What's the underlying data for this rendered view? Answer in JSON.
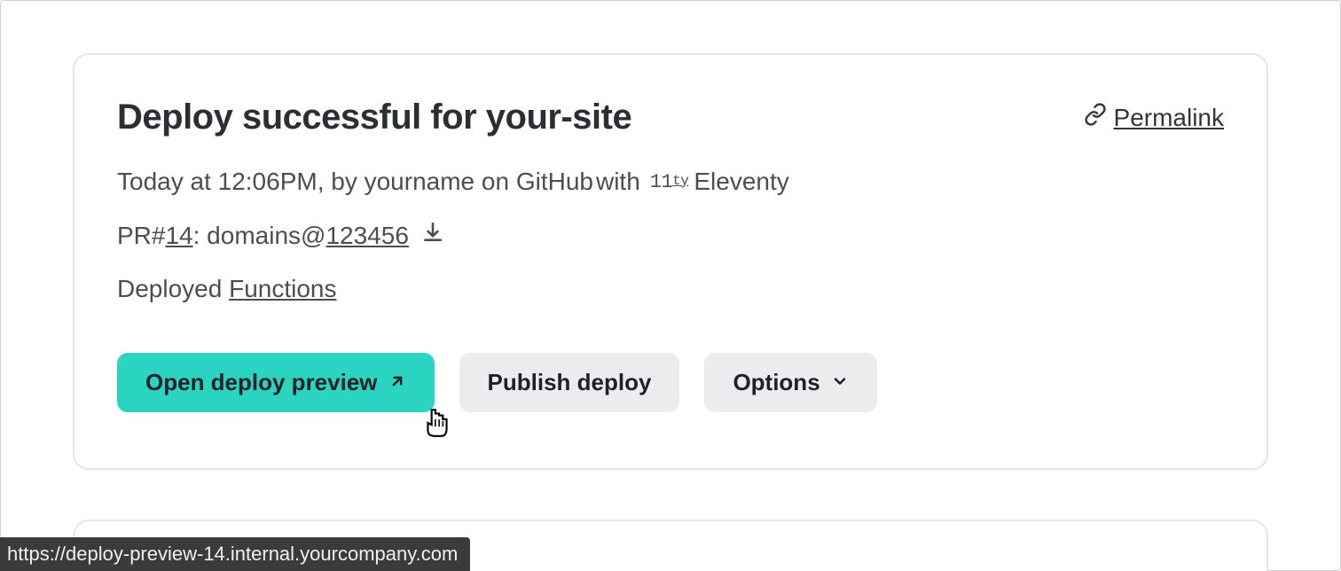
{
  "card": {
    "title": "Deploy successful for your-site",
    "permalink_label": "Permalink",
    "meta": {
      "prefix": "Today at 12:06PM, by yourname on GitHub",
      "with": " with ",
      "framework_badge": "11ty",
      "framework_name": "Eleventy"
    },
    "pr": {
      "prefix": "PR#",
      "number": "14",
      "domains_prefix": ": domains@",
      "commit": "123456"
    },
    "deployed": {
      "prefix": "Deployed ",
      "link": "Functions"
    },
    "buttons": {
      "open_preview": "Open deploy preview",
      "publish": "Publish deploy",
      "options": "Options"
    }
  },
  "status_bar": {
    "url": "https://deploy-preview-14.internal.yourcompany.com"
  }
}
